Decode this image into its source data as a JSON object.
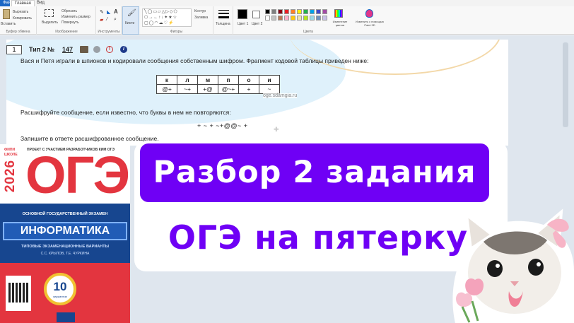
{
  "ribbon": {
    "tabs": [
      "Файл",
      "Главная",
      "Вид"
    ],
    "groups": {
      "clipboard": {
        "label": "Буфер обмена",
        "items": [
          "Вырезать",
          "Копировать",
          "Вставить"
        ]
      },
      "image": {
        "label": "Изображение",
        "items": [
          "Выделить",
          "Обрезать",
          "Изменить размер",
          "Повернуть"
        ]
      },
      "tools": {
        "label": "Инструменты"
      },
      "brushes": {
        "label": "Кисти"
      },
      "shapes": {
        "label": "Фигуры",
        "items": [
          "Контур",
          "Заливка"
        ]
      },
      "size": {
        "label": "Толщина"
      },
      "colors": {
        "label": "Цвета",
        "color1": "Цвет 1",
        "color2": "Цвет 2",
        "edit": "Изменение цветов",
        "paint3d": "Изменить с помощью Paint 3D"
      }
    },
    "palette_row1": [
      "#000000",
      "#7f7f7f",
      "#880015",
      "#ed1c24",
      "#ff7f27",
      "#fff200",
      "#22b14c",
      "#00a2e8",
      "#3f48cc",
      "#a349a4"
    ],
    "palette_row2": [
      "#ffffff",
      "#c3c3c3",
      "#b97a57",
      "#ffaec9",
      "#ffc90e",
      "#efe4b0",
      "#b5e61d",
      "#99d9ea",
      "#7092be",
      "#c8bfe7"
    ]
  },
  "task": {
    "number": "1",
    "type": "Тип 2 №",
    "id": "147",
    "line1": "Вася и Петя играли в шпионов и кодировали сообщения собственным шифром. Фрагмент кодовой таблицы приведен ниже:",
    "table_letters": [
      "к",
      "л",
      "м",
      "п",
      "о",
      "и"
    ],
    "table_codes": [
      "@+",
      "~+",
      "+@",
      "@~+",
      "+",
      "~"
    ],
    "watermark": "oge.sdamgia.ru",
    "line2": "Расшифруйте сообщение, если известно, что буквы в нем не повторяются:",
    "message": "+ ~ + ~+@@~ +",
    "line3": "Запишите в ответе расшифрованное сообщение."
  },
  "book": {
    "fipi": "ФИПИ",
    "school": "ШКОЛЕ",
    "project": "ПРОЕКТ С УЧАСТИЕМ РАЗРАБОТЧИКОВ КИМ ОГЭ",
    "year": "2026",
    "title": "ОГЭ",
    "exam": "ОСНОВНОЙ ГОСУДАРСТВЕННЫЙ ЭКЗАМЕН",
    "subject": "ИНФОРМАТИКА",
    "variants": "ТИПОВЫЕ ЭКЗАМЕНАЦИОННЫЕ ВАРИАНТЫ",
    "authors": "С.С. КРЫЛОВ, Т.Е. ЧУРКИНА",
    "count": "10",
    "count_label": "вариантов"
  },
  "banner": {
    "title": "Разбор 2 задания",
    "subtitle": "ОГЭ на пятерку"
  }
}
